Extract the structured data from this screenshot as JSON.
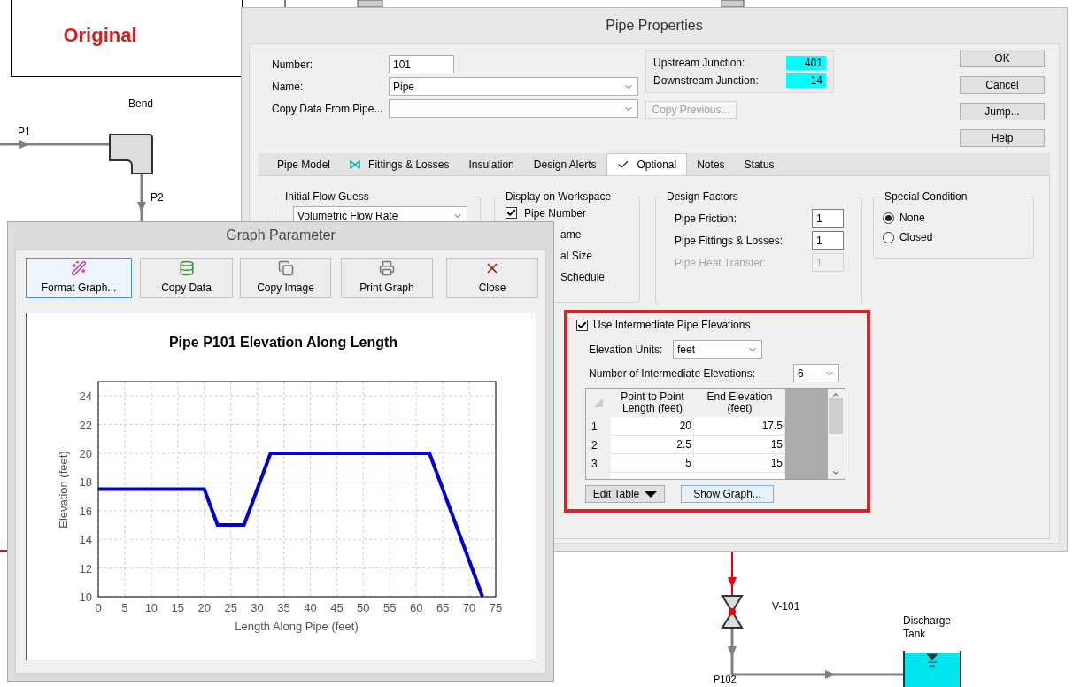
{
  "workspace": {
    "banner": "Original",
    "bend_label": "Bend",
    "pipe_labels": [
      "P1",
      "P2",
      "P102"
    ],
    "valve_label": "V-101",
    "tank_label": "Discharge Tank"
  },
  "pipe_properties": {
    "title": "Pipe Properties",
    "fields": [
      {
        "label": "Number:",
        "value": "101",
        "kind": "text"
      },
      {
        "label": "Name:",
        "value": "Pipe",
        "kind": "dropdown"
      },
      {
        "label": "Copy Data From Pipe...",
        "kind": "dropdown"
      }
    ],
    "junctions": [
      {
        "label": "Upstream Junction:",
        "value": "401"
      },
      {
        "label": "Downstream Junction:",
        "value": "14"
      }
    ],
    "copy_previous": {
      "label": "Copy Previous...",
      "disabled": true
    },
    "buttons": [
      "OK",
      "Cancel",
      "Jump...",
      "Help"
    ],
    "tabs": [
      {
        "label": "Pipe Model",
        "kind": "plain",
        "selected": false
      },
      {
        "label": "Fittings & Losses",
        "kind": "fittings",
        "selected": false
      },
      {
        "label": "Insulation",
        "kind": "plain",
        "selected": false
      },
      {
        "label": "Design Alerts",
        "kind": "plain",
        "selected": false
      },
      {
        "label": "Optional",
        "kind": "checked",
        "selected": true
      },
      {
        "label": "Notes",
        "kind": "plain",
        "selected": false
      },
      {
        "label": "Status",
        "kind": "plain",
        "selected": false
      }
    ],
    "initial_flow_guess": {
      "title": "Initial Flow Guess",
      "dropdown": "Volumetric Flow Rate"
    },
    "display_on_workspace": {
      "title": "Display on Workspace",
      "checkbox": {
        "label": "Pipe Number",
        "checked": true
      },
      "cut_labels": [
        "ame",
        "al Size",
        "Schedule"
      ]
    },
    "design_factors": {
      "title": "Design Factors",
      "rows": [
        {
          "label": "Pipe Friction:",
          "value": "1",
          "disabled": false
        },
        {
          "label": "Pipe Fittings & Losses:",
          "value": "1",
          "disabled": false
        },
        {
          "label": "Pipe Heat Transfer:",
          "value": "1",
          "disabled": true
        }
      ]
    },
    "special_condition": {
      "title": "Special Condition",
      "options": [
        {
          "label": "None",
          "selected": true
        },
        {
          "label": "Closed",
          "selected": false
        }
      ]
    },
    "intermediate": {
      "checkbox": {
        "label": "Use Intermediate Pipe Elevations",
        "checked": true
      },
      "units": {
        "label": "Elevation Units:",
        "value": "feet"
      },
      "count": {
        "label": "Number of Intermediate Elevations:",
        "value": "6"
      },
      "table": {
        "columns": [
          "Point to Point Length (feet)",
          "End Elevation (feet)"
        ],
        "rows": [
          {
            "index": "1",
            "cells": [
              "20",
              "17.5"
            ]
          },
          {
            "index": "2",
            "cells": [
              "2.5",
              "15"
            ]
          },
          {
            "index": "3",
            "cells": [
              "5",
              "15"
            ]
          }
        ]
      },
      "edit_table": "Edit Table",
      "show_graph": "Show Graph..."
    }
  },
  "graph_parameter": {
    "title": "Graph Parameter",
    "toolbar": [
      {
        "label": "Format Graph...",
        "selected": true
      },
      {
        "label": "Copy Data",
        "selected": false
      },
      {
        "label": "Copy Image",
        "selected": false
      },
      {
        "label": "Print Graph",
        "selected": false
      },
      {
        "label": "Close",
        "selected": false
      }
    ],
    "chart_data": {
      "type": "line",
      "title": "Pipe P101 Elevation Along Length",
      "xlabel": "Length Along Pipe (feet)",
      "ylabel": "Elevation (feet)",
      "x": [
        0,
        20,
        22.5,
        27.5,
        32.5,
        62.5,
        72.5
      ],
      "series": [
        {
          "color": "#0000c8",
          "values": [
            17.5,
            17.5,
            15,
            15,
            20,
            20,
            10
          ]
        }
      ],
      "grid": true,
      "xlim": [
        0,
        75
      ],
      "ylim": [
        10,
        25
      ],
      "xticks": [
        0,
        5,
        10,
        15,
        20,
        25,
        30,
        35,
        40,
        45,
        50,
        55,
        60,
        65,
        70,
        75
      ],
      "yticks": [
        10,
        12,
        14,
        16,
        18,
        20,
        22,
        24
      ]
    }
  }
}
